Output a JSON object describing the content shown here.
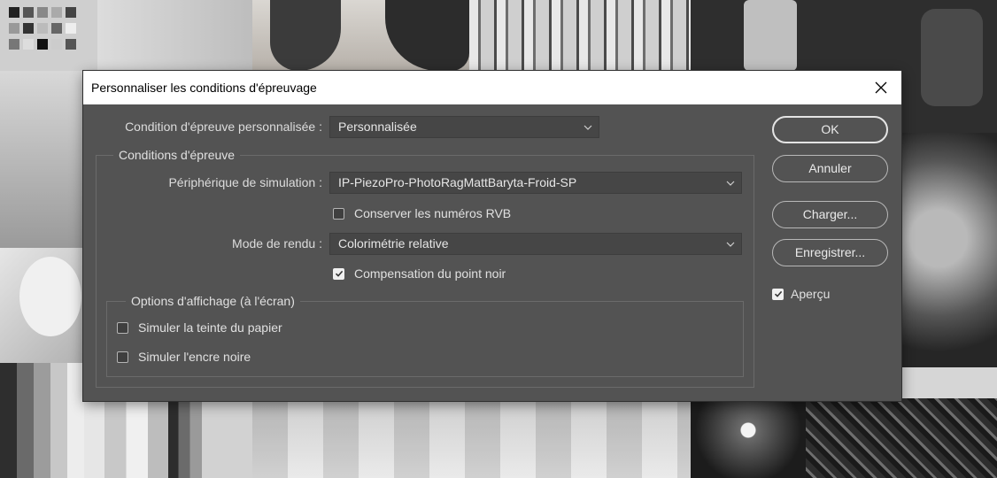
{
  "dialog": {
    "title": "Personnaliser les conditions d'épreuvage",
    "close_icon": "close-icon",
    "custom_condition": {
      "label": "Condition d'épreuve personnalisée :",
      "value": "Personnalisée"
    },
    "proof_conditions": {
      "legend": "Conditions d'épreuve",
      "device_label": "Périphérique de simulation :",
      "device_value": "IP-PiezoPro-PhotoRagMattBaryta-Froid-SP",
      "preserve_rgb": {
        "label": "Conserver les numéros RVB",
        "checked": false
      },
      "intent_label": "Mode de rendu :",
      "intent_value": "Colorimétrie relative",
      "black_point": {
        "label": "Compensation du point noir",
        "checked": true
      }
    },
    "display_options": {
      "legend": "Options d'affichage (à l'écran)",
      "paper_color": {
        "label": "Simuler la teinte du papier",
        "checked": false
      },
      "black_ink": {
        "label": "Simuler l'encre noire",
        "checked": false
      }
    },
    "buttons": {
      "ok": "OK",
      "cancel": "Annuler",
      "load": "Charger...",
      "save": "Enregistrer..."
    },
    "preview": {
      "label": "Aperçu",
      "checked": true
    }
  },
  "colors": {
    "dialog_bg": "#535353",
    "control_bg": "#464646",
    "text": "#e0e0e0",
    "titlebar_bg": "#ffffff"
  }
}
